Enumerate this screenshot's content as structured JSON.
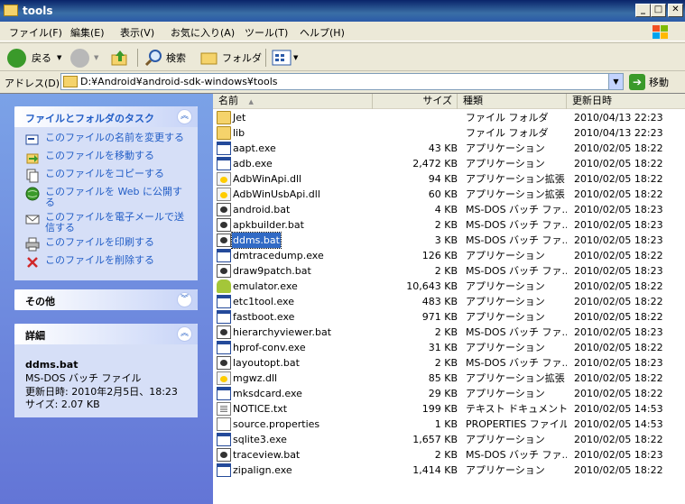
{
  "window": {
    "title": "tools",
    "min_label": "_",
    "max_label": "□",
    "close_label": "✕"
  },
  "menu": [
    "ファイル(F)",
    "編集(E)",
    "表示(V)",
    "お気に入り(A)",
    "ツール(T)",
    "ヘルプ(H)"
  ],
  "toolbar": {
    "back": "戻る",
    "search": "検索",
    "folders": "フォルダ"
  },
  "address": {
    "label": "アドレス(D)",
    "value": "D:¥Android¥android-sdk-windows¥tools",
    "go": "移動"
  },
  "tasks": {
    "title": "ファイルとフォルダのタスク",
    "items": [
      {
        "label": "このファイルの名前を変更する",
        "icon": "rename-icon"
      },
      {
        "label": "このファイルを移動する",
        "icon": "move-icon"
      },
      {
        "label": "このファイルをコピーする",
        "icon": "copy-icon"
      },
      {
        "label": "このファイルを Web に公開する",
        "icon": "web-publish-icon"
      },
      {
        "label": "このファイルを電子メールで送信する",
        "icon": "email-icon"
      },
      {
        "label": "このファイルを印刷する",
        "icon": "print-icon"
      },
      {
        "label": "このファイルを削除する",
        "icon": "delete-icon"
      }
    ]
  },
  "other": {
    "title": "その他"
  },
  "details": {
    "title": "詳細",
    "name": "ddms.bat",
    "type": "MS-DOS バッチ ファイル",
    "modified": "更新日時: 2010年2月5日、18:23",
    "size": "サイズ: 2.07 KB"
  },
  "columns": {
    "name": "名前",
    "size": "サイズ",
    "type": "種類",
    "date": "更新日時"
  },
  "files": [
    {
      "name": "Jet",
      "size": "",
      "type": "ファイル フォルダ",
      "date": "2010/04/13 22:23",
      "icon": "folder"
    },
    {
      "name": "lib",
      "size": "",
      "type": "ファイル フォルダ",
      "date": "2010/04/13 22:23",
      "icon": "folder"
    },
    {
      "name": "aapt.exe",
      "size": "43 KB",
      "type": "アプリケーション",
      "date": "2010/02/05 18:22",
      "icon": "exe"
    },
    {
      "name": "adb.exe",
      "size": "2,472 KB",
      "type": "アプリケーション",
      "date": "2010/02/05 18:22",
      "icon": "exe"
    },
    {
      "name": "AdbWinApi.dll",
      "size": "94 KB",
      "type": "アプリケーション拡張",
      "date": "2010/02/05 18:22",
      "icon": "dll"
    },
    {
      "name": "AdbWinUsbApi.dll",
      "size": "60 KB",
      "type": "アプリケーション拡張",
      "date": "2010/02/05 18:22",
      "icon": "dll"
    },
    {
      "name": "android.bat",
      "size": "4 KB",
      "type": "MS-DOS バッチ ファ...",
      "date": "2010/02/05 18:23",
      "icon": "bat"
    },
    {
      "name": "apkbuilder.bat",
      "size": "2 KB",
      "type": "MS-DOS バッチ ファ...",
      "date": "2010/02/05 18:23",
      "icon": "bat"
    },
    {
      "name": "ddms.bat",
      "size": "3 KB",
      "type": "MS-DOS バッチ ファ...",
      "date": "2010/02/05 18:23",
      "icon": "bat",
      "selected": true
    },
    {
      "name": "dmtracedump.exe",
      "size": "126 KB",
      "type": "アプリケーション",
      "date": "2010/02/05 18:22",
      "icon": "exe"
    },
    {
      "name": "draw9patch.bat",
      "size": "2 KB",
      "type": "MS-DOS バッチ ファ...",
      "date": "2010/02/05 18:23",
      "icon": "bat"
    },
    {
      "name": "emulator.exe",
      "size": "10,643 KB",
      "type": "アプリケーション",
      "date": "2010/02/05 18:22",
      "icon": "android"
    },
    {
      "name": "etc1tool.exe",
      "size": "483 KB",
      "type": "アプリケーション",
      "date": "2010/02/05 18:22",
      "icon": "exe"
    },
    {
      "name": "fastboot.exe",
      "size": "971 KB",
      "type": "アプリケーション",
      "date": "2010/02/05 18:22",
      "icon": "exe"
    },
    {
      "name": "hierarchyviewer.bat",
      "size": "2 KB",
      "type": "MS-DOS バッチ ファ...",
      "date": "2010/02/05 18:23",
      "icon": "bat"
    },
    {
      "name": "hprof-conv.exe",
      "size": "31 KB",
      "type": "アプリケーション",
      "date": "2010/02/05 18:22",
      "icon": "exe"
    },
    {
      "name": "layoutopt.bat",
      "size": "2 KB",
      "type": "MS-DOS バッチ ファ...",
      "date": "2010/02/05 18:23",
      "icon": "bat"
    },
    {
      "name": "mgwz.dll",
      "size": "85 KB",
      "type": "アプリケーション拡張",
      "date": "2010/02/05 18:22",
      "icon": "dll"
    },
    {
      "name": "mksdcard.exe",
      "size": "29 KB",
      "type": "アプリケーション",
      "date": "2010/02/05 18:22",
      "icon": "exe"
    },
    {
      "name": "NOTICE.txt",
      "size": "199 KB",
      "type": "テキスト ドキュメント",
      "date": "2010/02/05 14:53",
      "icon": "txt"
    },
    {
      "name": "source.properties",
      "size": "1 KB",
      "type": "PROPERTIES ファイル",
      "date": "2010/02/05 14:53",
      "icon": "prop"
    },
    {
      "name": "sqlite3.exe",
      "size": "1,657 KB",
      "type": "アプリケーション",
      "date": "2010/02/05 18:22",
      "icon": "exe"
    },
    {
      "name": "traceview.bat",
      "size": "2 KB",
      "type": "MS-DOS バッチ ファ...",
      "date": "2010/02/05 18:23",
      "icon": "bat"
    },
    {
      "name": "zipalign.exe",
      "size": "1,414 KB",
      "type": "アプリケーション",
      "date": "2010/02/05 18:22",
      "icon": "exe"
    }
  ],
  "colors": {
    "title_bar": "#0a246a",
    "task_link": "#215dc6",
    "selection": "#316ac5"
  }
}
